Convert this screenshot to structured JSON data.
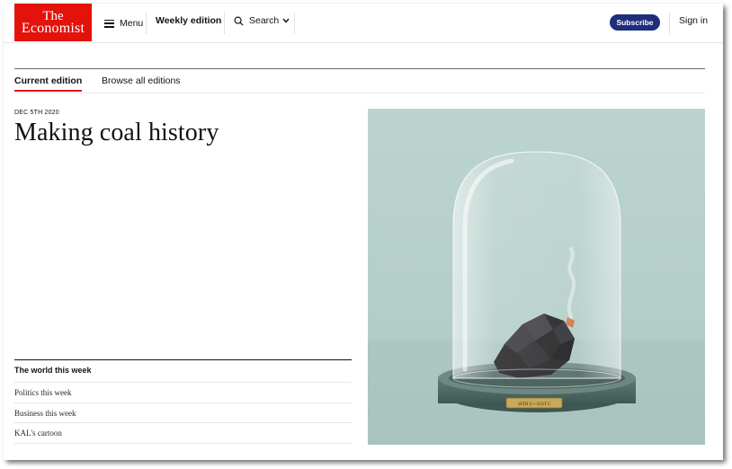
{
  "header": {
    "logo_line1": "The",
    "logo_line2": "Economist",
    "menu_label": "Menu",
    "weekly_label": "Weekly edition",
    "search_label": "Search",
    "subscribe_label": "Subscribe",
    "signin_label": "Sign in"
  },
  "tabs": [
    {
      "label": "Current edition"
    },
    {
      "label": "Browse all editions"
    }
  ],
  "edition": {
    "date": "DEC 5TH 2020",
    "headline": "Making coal history"
  },
  "section": {
    "title": "The world this week",
    "links": [
      {
        "label": "Politics this week"
      },
      {
        "label": "Business this week"
      },
      {
        "label": "KAL's cartoon"
      }
    ]
  },
  "cover": {
    "plaque_text": "18TH C—21ST C"
  },
  "colors": {
    "brand_red": "#e3120b",
    "subscribe_blue": "#1f2e7a",
    "cover_background": "#b6cfca"
  }
}
